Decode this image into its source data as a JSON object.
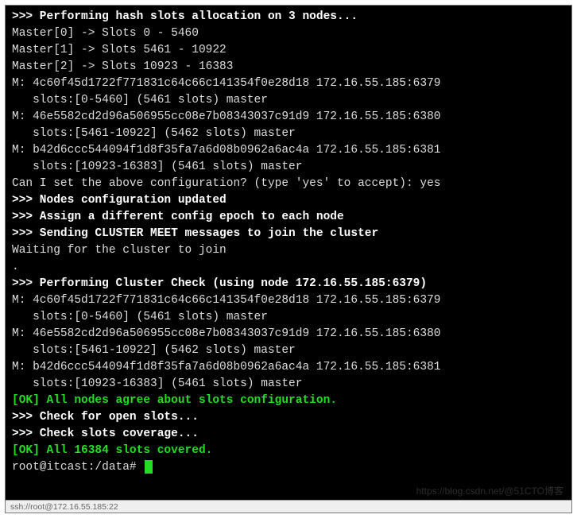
{
  "lines": [
    {
      "cls": "bold",
      "text": ">>> Performing hash slots allocation on 3 nodes..."
    },
    {
      "cls": "",
      "text": "Master[0] -> Slots 0 - 5460"
    },
    {
      "cls": "",
      "text": "Master[1] -> Slots 5461 - 10922"
    },
    {
      "cls": "",
      "text": "Master[2] -> Slots 10923 - 16383"
    },
    {
      "cls": "",
      "text": "M: 4c60f45d1722f771831c64c66c141354f0e28d18 172.16.55.185:6379"
    },
    {
      "cls": "",
      "text": "   slots:[0-5460] (5461 slots) master"
    },
    {
      "cls": "",
      "text": "M: 46e5582cd2d96a506955cc08e7b08343037c91d9 172.16.55.185:6380"
    },
    {
      "cls": "",
      "text": "   slots:[5461-10922] (5462 slots) master"
    },
    {
      "cls": "",
      "text": "M: b42d6ccc544094f1d8f35fa7a6d08b0962a6ac4a 172.16.55.185:6381"
    },
    {
      "cls": "",
      "text": "   slots:[10923-16383] (5461 slots) master"
    },
    {
      "cls": "",
      "text": "Can I set the above configuration? (type 'yes' to accept): yes"
    },
    {
      "cls": "bold",
      "text": ">>> Nodes configuration updated"
    },
    {
      "cls": "bold",
      "text": ">>> Assign a different config epoch to each node"
    },
    {
      "cls": "bold",
      "text": ">>> Sending CLUSTER MEET messages to join the cluster"
    },
    {
      "cls": "",
      "text": "Waiting for the cluster to join"
    },
    {
      "cls": "",
      "text": "."
    },
    {
      "cls": "bold",
      "text": ">>> Performing Cluster Check (using node 172.16.55.185:6379)"
    },
    {
      "cls": "",
      "text": "M: 4c60f45d1722f771831c64c66c141354f0e28d18 172.16.55.185:6379"
    },
    {
      "cls": "",
      "text": "   slots:[0-5460] (5461 slots) master"
    },
    {
      "cls": "",
      "text": "M: 46e5582cd2d96a506955cc08e7b08343037c91d9 172.16.55.185:6380"
    },
    {
      "cls": "",
      "text": "   slots:[5461-10922] (5462 slots) master"
    },
    {
      "cls": "",
      "text": "M: b42d6ccc544094f1d8f35fa7a6d08b0962a6ac4a 172.16.55.185:6381"
    },
    {
      "cls": "",
      "text": "   slots:[10923-16383] (5461 slots) master"
    },
    {
      "cls": "ok",
      "text": "[OK] All nodes agree about slots configuration."
    },
    {
      "cls": "bold",
      "text": ">>> Check for open slots..."
    },
    {
      "cls": "bold",
      "text": ">>> Check slots coverage..."
    },
    {
      "cls": "ok",
      "text": "[OK] All 16384 slots covered."
    }
  ],
  "prompt": "root@itcast:/data# ",
  "watermark": "https://blog.csdn.net/@51CTO博客",
  "status_bar": "ssh://root@172.16.55.185:22"
}
